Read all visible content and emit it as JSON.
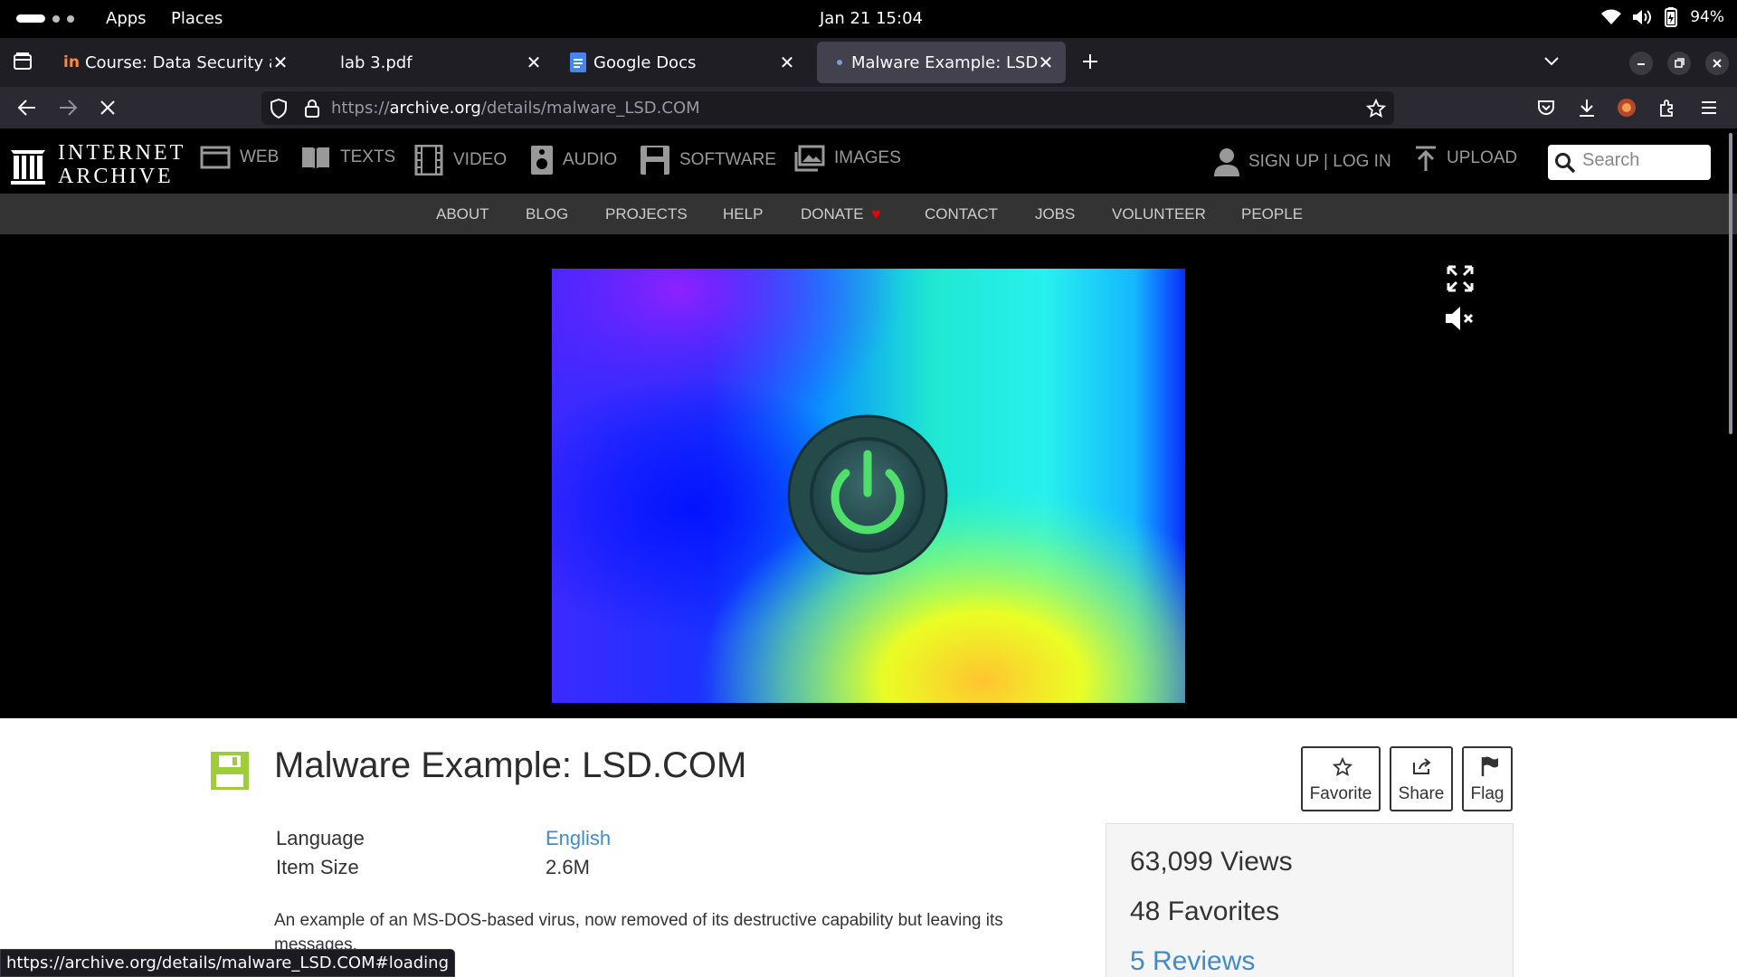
{
  "system": {
    "apps_label": "Apps",
    "places_label": "Places",
    "clock": "Jan 21  15:04",
    "battery": "94%"
  },
  "tabs": [
    {
      "title": "Course: Data Security and",
      "favicon": "in-icon"
    },
    {
      "title": "lab 3.pdf",
      "favicon": "pdf-icon"
    },
    {
      "title": "Google Docs",
      "favicon": "docs-icon"
    },
    {
      "title": "Malware Example: LSD.COM",
      "favicon": "dot-icon",
      "active": true
    }
  ],
  "address": {
    "scheme": "https://",
    "host": "archive.org",
    "path": "/details/malware_LSD.COM"
  },
  "ia_header": {
    "logo_line1": "INTERNET",
    "logo_line2": "ARCHIVE",
    "nav": [
      "WEB",
      "TEXTS",
      "VIDEO",
      "AUDIO",
      "SOFTWARE",
      "IMAGES"
    ],
    "signup": "SIGN UP | LOG IN",
    "upload": "UPLOAD",
    "search_placeholder": "Search"
  },
  "sub_nav": [
    "ABOUT",
    "BLOG",
    "PROJECTS",
    "HELP",
    "DONATE",
    "CONTACT",
    "JOBS",
    "VOLUNTEER",
    "PEOPLE"
  ],
  "item": {
    "title": "Malware Example: LSD.COM",
    "actions": {
      "favorite": "Favorite",
      "share": "Share",
      "flag": "Flag"
    },
    "metadata": [
      {
        "key": "Language",
        "value": "English",
        "link": true
      },
      {
        "key": "Item Size",
        "value": "2.6M",
        "link": false
      }
    ],
    "description": "An example of an MS-DOS-based virus, now removed of its destructive capability but leaving its messages."
  },
  "stats": {
    "views": "63,099 Views",
    "favorites": "48 Favorites",
    "reviews": "5 Reviews"
  },
  "status_url": "https://archive.org/details/malware_LSD.COM#loading",
  "colors": {
    "accent_link": "#428bca",
    "software_green": "#9ecc3b",
    "power_green": "#4fe06b"
  }
}
